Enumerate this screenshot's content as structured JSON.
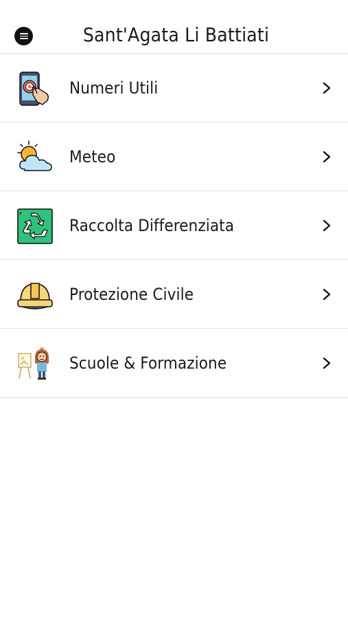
{
  "header": {
    "title": "Sant'Agata Li Battiati",
    "menu_icon": "menu-icon"
  },
  "menu": {
    "items": [
      {
        "label": "Numeri Utili",
        "icon": "phone-touch-icon"
      },
      {
        "label": "Meteo",
        "icon": "sun-cloud-icon"
      },
      {
        "label": "Raccolta Differenziata",
        "icon": "recycle-icon"
      },
      {
        "label": "Protezione Civile",
        "icon": "hard-hat-icon"
      },
      {
        "label": "Scuole & Formazione",
        "icon": "student-easel-icon"
      }
    ],
    "chevron_icon": "chevron-right-icon"
  },
  "colors": {
    "background": "#ffffff",
    "divider": "#e6e6e6",
    "text": "#1a1a1a",
    "menu_button": "#111111"
  }
}
